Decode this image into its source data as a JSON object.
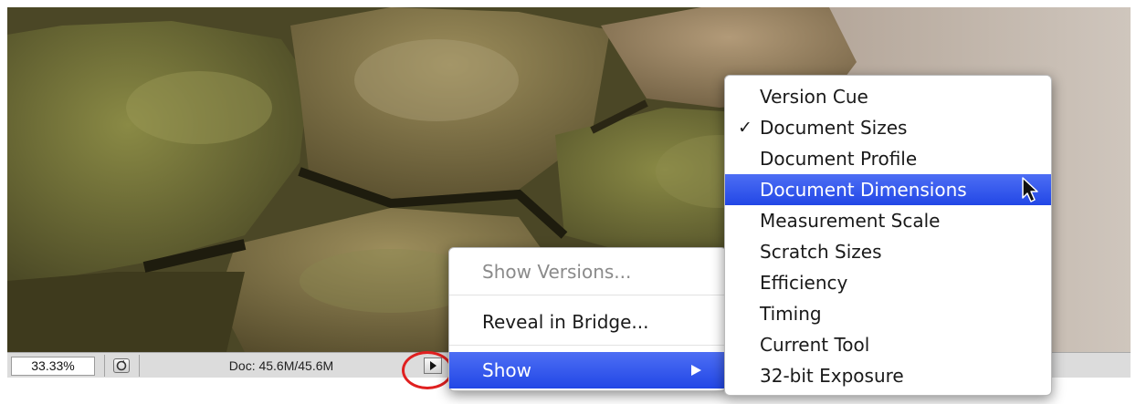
{
  "statusbar": {
    "zoom": "33.33%",
    "doc_info": "Doc: 45.6M/45.6M"
  },
  "icons": {
    "preferences": "circular-arrow-icon",
    "flyout": "triangle-right-icon",
    "submenu": "triangle-right-icon",
    "check": "checkmark-icon",
    "cursor": "mouse-pointer-icon"
  },
  "main_menu": {
    "items": [
      {
        "label": "Show Versions...",
        "enabled": false
      },
      {
        "label": "Reveal in Bridge...",
        "enabled": true
      },
      {
        "label": "Show",
        "enabled": true,
        "selected": true,
        "has_submenu": true
      }
    ]
  },
  "show_submenu": {
    "items": [
      {
        "label": "Version Cue",
        "checked": false
      },
      {
        "label": "Document Sizes",
        "checked": true
      },
      {
        "label": "Document Profile",
        "checked": false
      },
      {
        "label": "Document Dimensions",
        "checked": false,
        "highlighted": true
      },
      {
        "label": "Measurement Scale",
        "checked": false
      },
      {
        "label": "Scratch Sizes",
        "checked": false
      },
      {
        "label": "Efficiency",
        "checked": false
      },
      {
        "label": "Timing",
        "checked": false
      },
      {
        "label": "Current Tool",
        "checked": false
      },
      {
        "label": "32-bit Exposure",
        "checked": false
      }
    ],
    "check_glyph": "✓"
  },
  "colors": {
    "selection": "#2f57ea",
    "annotation_ring": "#e02020"
  }
}
